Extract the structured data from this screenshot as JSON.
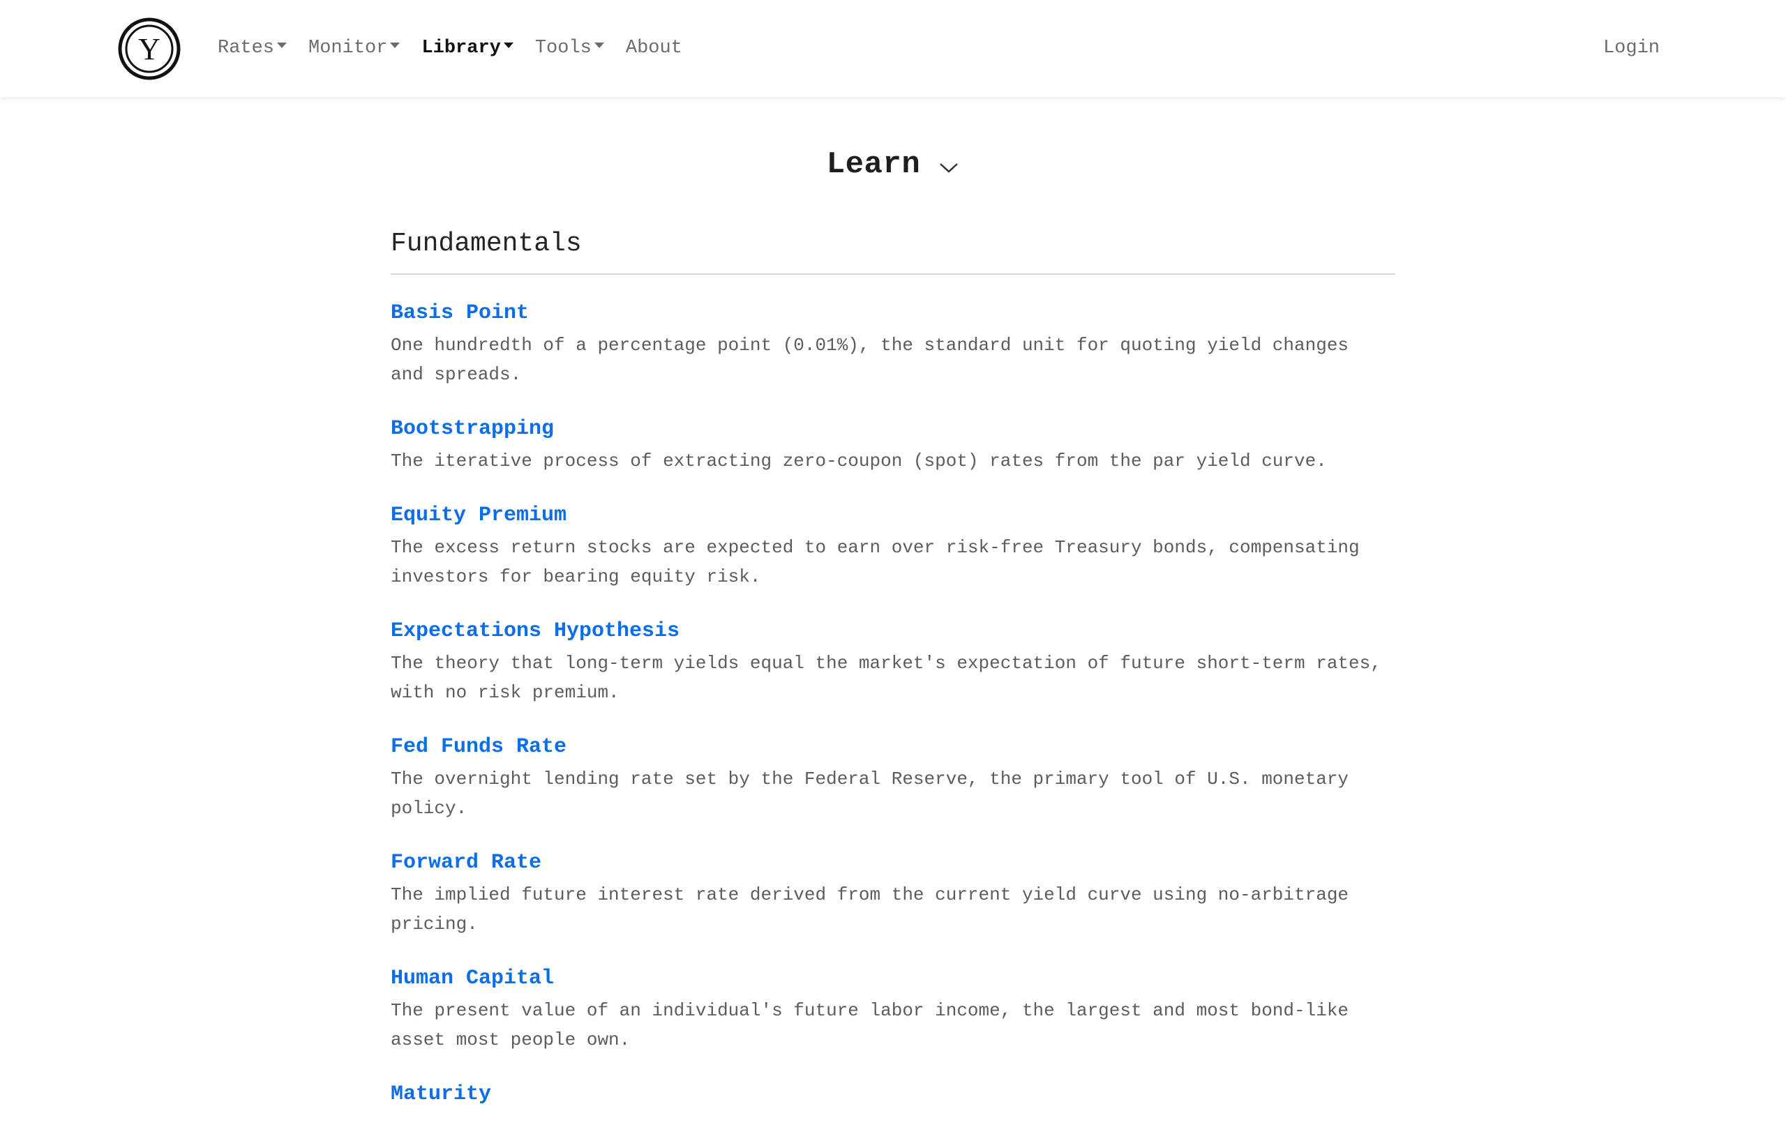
{
  "nav": {
    "logo_letter": "Y",
    "items": [
      {
        "label": "Rates",
        "has_dropdown": true,
        "active": false
      },
      {
        "label": "Monitor",
        "has_dropdown": true,
        "active": false
      },
      {
        "label": "Library",
        "has_dropdown": true,
        "active": true
      },
      {
        "label": "Tools",
        "has_dropdown": true,
        "active": false
      },
      {
        "label": "About",
        "has_dropdown": false,
        "active": false
      }
    ],
    "login_label": "Login"
  },
  "header": {
    "title": "Learn",
    "icon": "chevron-down-icon"
  },
  "section": {
    "title": "Fundamentals",
    "terms": [
      {
        "name": "Basis Point",
        "description": "One hundredth of a percentage point (0.01%), the standard unit for quoting yield changes and spreads."
      },
      {
        "name": "Bootstrapping",
        "description": "The iterative process of extracting zero-coupon (spot) rates from the par yield curve."
      },
      {
        "name": "Equity Premium",
        "description": "The excess return stocks are expected to earn over risk-free Treasury bonds, compensating investors for bearing equity risk."
      },
      {
        "name": "Expectations Hypothesis",
        "description": "The theory that long-term yields equal the market's expectation of future short-term rates, with no risk premium."
      },
      {
        "name": "Fed Funds Rate",
        "description": "The overnight lending rate set by the Federal Reserve, the primary tool of U.S. monetary policy."
      },
      {
        "name": "Forward Rate",
        "description": "The implied future interest rate derived from the current yield curve using no-arbitrage pricing."
      },
      {
        "name": "Human Capital",
        "description": "The present value of an individual's future labor income, the largest and most bond-like asset most people own."
      },
      {
        "name": "Maturity",
        "description": ""
      }
    ]
  },
  "colors": {
    "link": "#0b6de8",
    "nav_text": "#6c6c6c",
    "nav_active": "#111111",
    "body_text": "#5c5c5c"
  }
}
